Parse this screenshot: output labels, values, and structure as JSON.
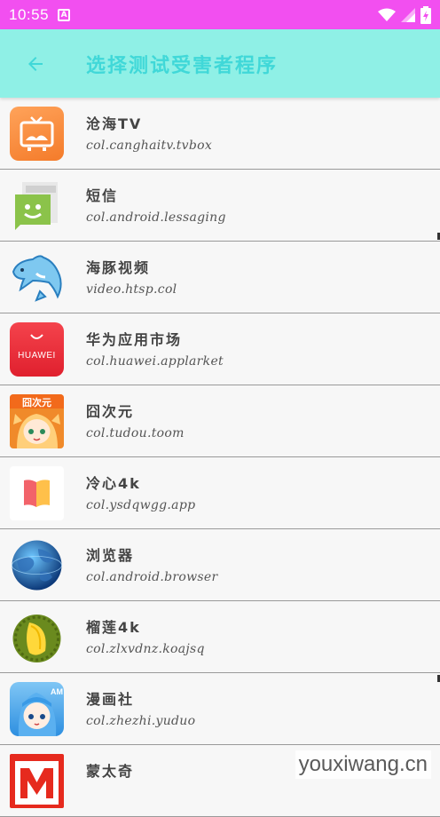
{
  "status_bar": {
    "time": "10:55",
    "notification_icon": "a-notification-icon",
    "wifi_icon": "wifi-icon",
    "signal_icon": "signal-icon",
    "battery_icon": "battery-charging-icon"
  },
  "toolbar": {
    "back_icon": "arrow-back-icon",
    "title": "选择测试受害者程序",
    "background": "#8ff0e6",
    "title_color": "#40d8d8"
  },
  "apps": [
    {
      "name": "沧海TV",
      "package": "col.canghaitv.tvbox",
      "icon": "tv-icon"
    },
    {
      "name": "短信",
      "package": "col.android.lessaging",
      "icon": "messaging-icon"
    },
    {
      "name": "海豚视频",
      "package": "video.htsp.col",
      "icon": "dolphin-icon"
    },
    {
      "name": "华为应用市场",
      "package": "col.huawei.applarket",
      "icon": "huawei-appgallery-icon"
    },
    {
      "name": "囧次元",
      "package": "col.tudou.toom",
      "icon": "anime-girl-icon"
    },
    {
      "name": "冷心4k",
      "package": "col.ysdqwgg.app",
      "icon": "book-icon"
    },
    {
      "name": "浏览器",
      "package": "col.android.browser",
      "icon": "globe-icon"
    },
    {
      "name": "榴莲4k",
      "package": "col.zlxvdnz.koajsq",
      "icon": "durian-icon"
    },
    {
      "name": "漫画社",
      "package": "col.zhezhi.yuduo",
      "icon": "manga-girl-icon"
    },
    {
      "name": "蒙太奇",
      "package": "",
      "icon": "m-logo-icon"
    }
  ],
  "watermark": "youxiwang.cn"
}
